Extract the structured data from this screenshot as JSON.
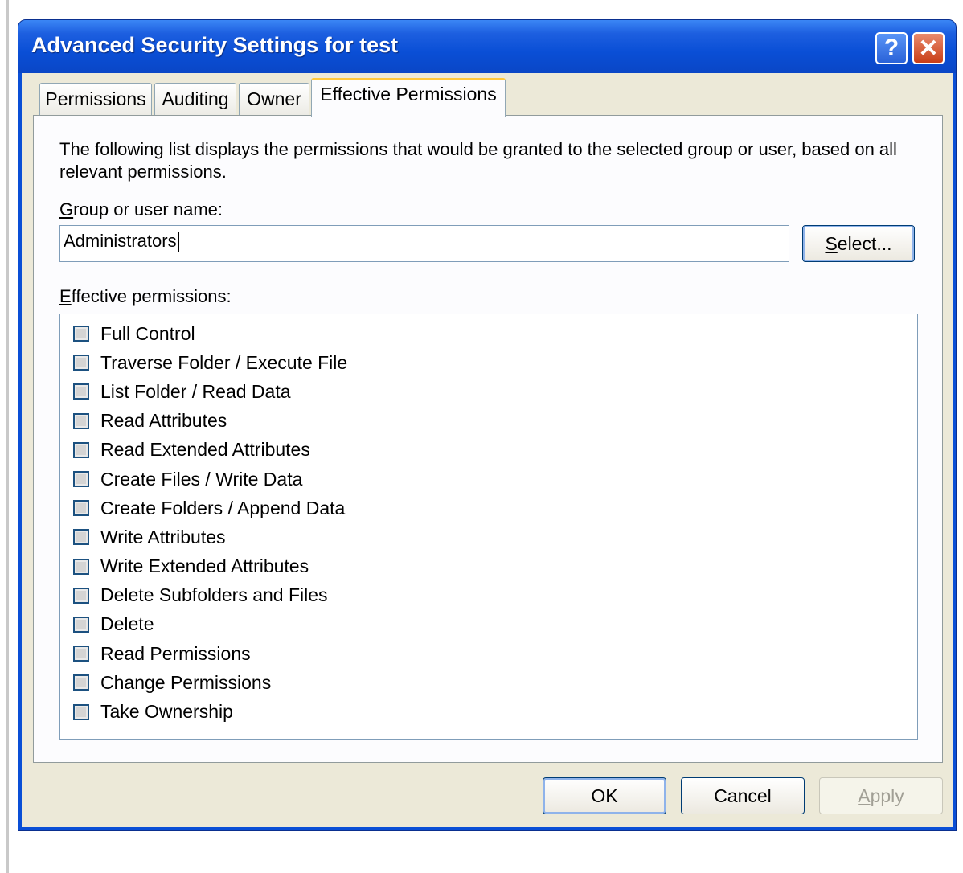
{
  "window": {
    "title": "Advanced Security Settings for test",
    "help_glyph": "?",
    "close_glyph": "✕"
  },
  "tabs": [
    {
      "label": "Permissions",
      "active": false
    },
    {
      "label": "Auditing",
      "active": false
    },
    {
      "label": "Owner",
      "active": false
    },
    {
      "label": "Effective Permissions",
      "active": true
    }
  ],
  "panel": {
    "description": "The following list displays the permissions that would be granted to the selected group or user, based on all relevant permissions.",
    "group_label_accel": "G",
    "group_label_rest": "roup or user name:",
    "group_value": "Administrators",
    "select_accel": "S",
    "select_rest": "elect...",
    "effective_label_accel": "E",
    "effective_label_rest": "ffective permissions:",
    "permissions": [
      "Full Control",
      "Traverse Folder / Execute File",
      "List Folder / Read Data",
      "Read Attributes",
      "Read Extended Attributes",
      "Create Files / Write Data",
      "Create Folders / Append Data",
      "Write Attributes",
      "Write Extended Attributes",
      "Delete Subfolders and Files",
      "Delete",
      "Read Permissions",
      "Change Permissions",
      "Take Ownership"
    ]
  },
  "buttons": {
    "ok": "OK",
    "cancel": "Cancel",
    "apply_accel": "A",
    "apply_rest": "pply"
  },
  "colors": {
    "titlebar": "#0a4fd6",
    "client": "#ece9d8",
    "active_tab_accent": "#ffc83c",
    "close_button": "#c93e16"
  }
}
